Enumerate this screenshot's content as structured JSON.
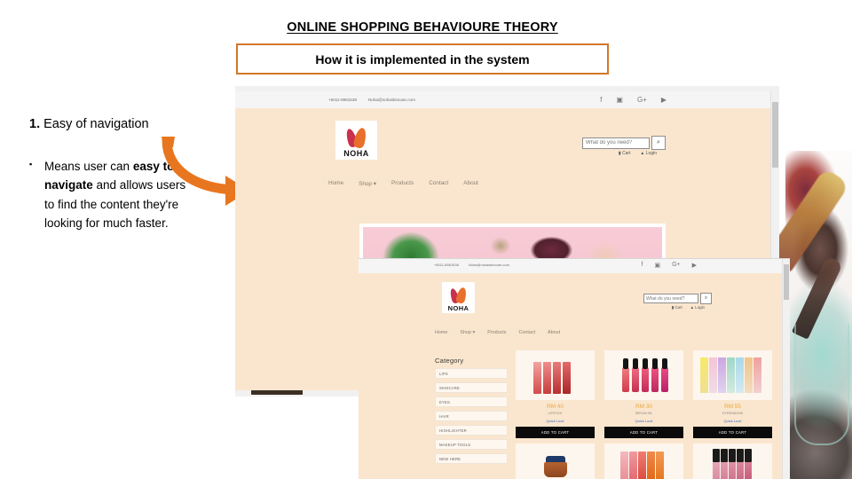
{
  "slide": {
    "title": "ONLINE SHOPPING BEHAVIOURE THEORY",
    "subtitle": "How it is implemented in the system",
    "accent_color": "#D4762A",
    "arrow_color": "#E8761F",
    "site_bg_color": "#FAE6CE"
  },
  "content": {
    "number": "1.",
    "heading": "Easy of navigation",
    "bullet_glyph": "▪",
    "bullet_text_1": "Means user can ",
    "bullet_bold_1": "easy to navigate",
    "bullet_text_2": " and allows users to find the content they're looking for much faster."
  },
  "window1": {
    "topbar": {
      "phone": "+6011-8981538",
      "email": "Noha@nohaskincare.com",
      "socials": [
        "facebook-icon",
        "instagram-icon",
        "googleplus-icon",
        "youtube-icon"
      ],
      "social_glyphs": [
        "f",
        "▣",
        "G+",
        "▶"
      ]
    },
    "logo": "NOHA",
    "search": {
      "placeholder": "What do you need?",
      "value": "",
      "button_icon": "search-icon",
      "button_glyph": "⌕"
    },
    "user_links": [
      {
        "icon": "cart-icon",
        "glyph": "🛒",
        "label": "Cart"
      },
      {
        "icon": "user-icon",
        "glyph": "👤",
        "label": "Login"
      }
    ],
    "nav": [
      "Home",
      "Shop ▾",
      "Products",
      "Contact",
      "About"
    ]
  },
  "window2": {
    "topbar": {
      "phone": "+6011-8981538",
      "email": "Noha@nohaskincare.com",
      "social_glyphs": [
        "f",
        "▣",
        "G+",
        "▶"
      ]
    },
    "logo": "NOHA",
    "search": {
      "placeholder": "What do you need?",
      "value": "",
      "button_glyph": "⌕"
    },
    "user_links": [
      {
        "glyph": "🛒",
        "label": "Cart"
      },
      {
        "glyph": "👤",
        "label": "Login"
      }
    ],
    "nav": [
      "Home",
      "Shop ▾",
      "Products",
      "Contact",
      "About"
    ],
    "prev_arrow_glyph": "‹",
    "category": {
      "title": "Category",
      "items": [
        "LIPS",
        "SKINCARE",
        "EYES",
        "HAIR",
        "HIGHLIGHTER",
        "MAKEUP TOOLS",
        "NEW HERE"
      ]
    },
    "products": [
      {
        "price": "RM 40",
        "name": "LIPSTICK",
        "quick_look": "Quick Look",
        "add_label": "ADD TO CART",
        "art": "lipsticks"
      },
      {
        "price": "RM 30",
        "name": "SERUM OIL",
        "quick_look": "Quick Look",
        "add_label": "ADD TO CART",
        "art": "drops"
      },
      {
        "price": "RM 55",
        "name": "EYESHADOW",
        "quick_look": "Quick Look",
        "add_label": "ADD TO CART",
        "art": "palette"
      }
    ],
    "products_row2": [
      {
        "art": "jarprod"
      },
      {
        "art": "lipsticks2"
      },
      {
        "art": "glosses"
      }
    ]
  }
}
